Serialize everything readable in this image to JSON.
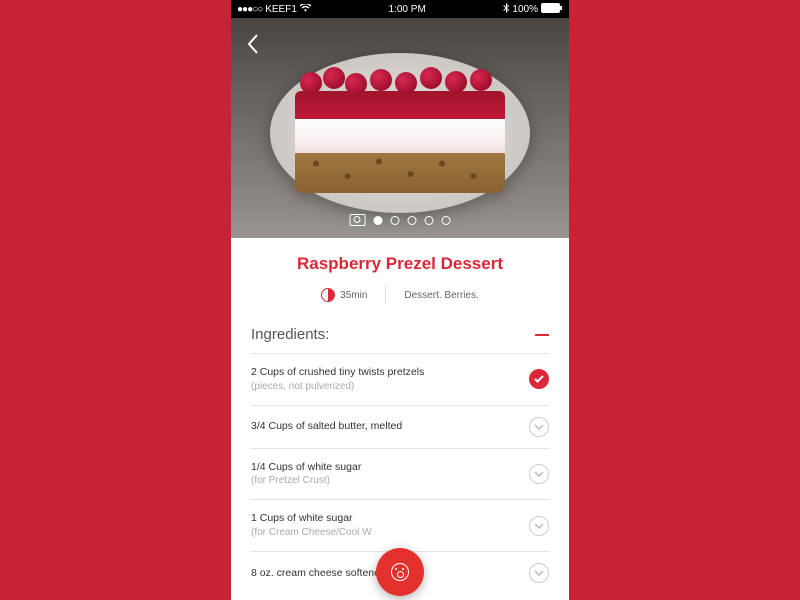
{
  "status": {
    "carrier": "KEEF1",
    "time": "1:00 PM",
    "battery": "100%"
  },
  "recipe": {
    "title": "Raspberry Prezel Dessert",
    "time": "35min",
    "tags": "Dessert. Berries."
  },
  "section": "Ingredients:",
  "ing": [
    {
      "t": "2 Cups of crushed tiny twists pretzels",
      "s": "(pieces, not pulverized)",
      "on": true
    },
    {
      "t": "3/4 Cups of salted butter, melted",
      "s": "",
      "on": false
    },
    {
      "t": "1/4 Cups of white sugar",
      "s": "(for Pretzel Crust)",
      "on": false
    },
    {
      "t": "1 Cups of white sugar",
      "s": "(for Cream Cheese/Cool W",
      "on": false
    },
    {
      "t": "8 oz. cream cheese softened",
      "s": "",
      "on": false
    }
  ]
}
